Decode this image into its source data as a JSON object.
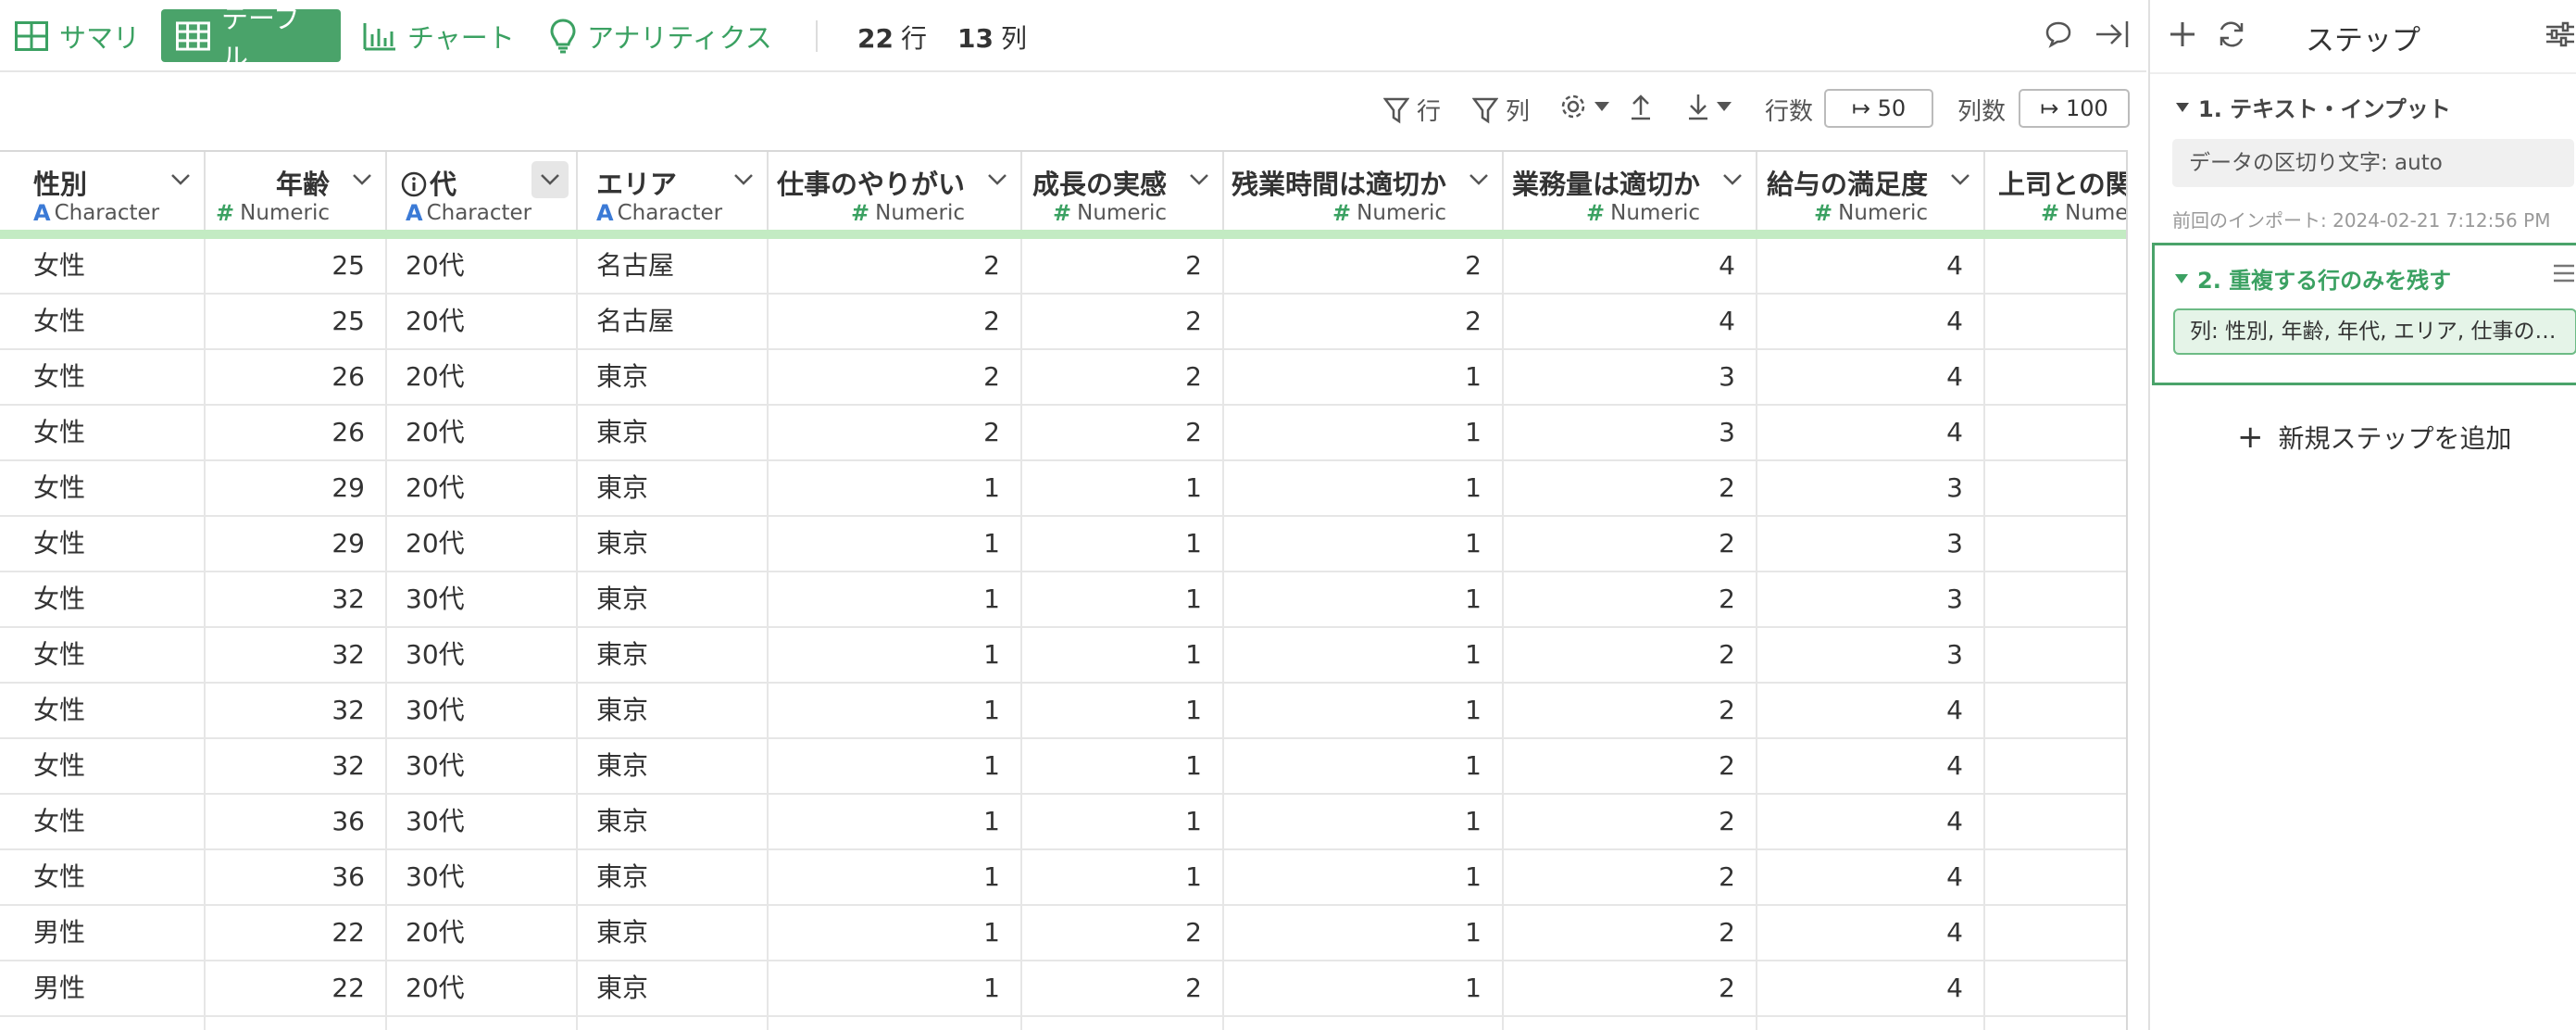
{
  "tabs": [
    {
      "label": "サマリ",
      "icon": "table-grid-icon"
    },
    {
      "label": "テーブル",
      "icon": "table-icon",
      "active": true
    },
    {
      "label": "チャート",
      "icon": "bar-chart-icon"
    },
    {
      "label": "アナリティクス",
      "icon": "lightbulb-icon"
    }
  ],
  "counts": {
    "rows_num": "22",
    "rows_unit": "行",
    "cols_num": "13",
    "cols_unit": "列"
  },
  "toolbar": {
    "row_filter": "行",
    "col_filter": "列",
    "row_count_label": "行数",
    "row_count_value": "↦ 50",
    "col_count_label": "列数",
    "col_count_value": "↦ 100"
  },
  "columns": [
    {
      "name": "性別",
      "type": "Character",
      "kind": "char"
    },
    {
      "name": "年齢",
      "type": "Numeric",
      "kind": "num"
    },
    {
      "name": "代",
      "type": "Character",
      "kind": "char"
    },
    {
      "name": "エリア",
      "type": "Character",
      "kind": "char"
    },
    {
      "name": "仕事のやりがい",
      "type": "Numeric",
      "kind": "num"
    },
    {
      "name": "成長の実感",
      "type": "Numeric",
      "kind": "num"
    },
    {
      "name": "残業時間は適切か",
      "type": "Numeric",
      "kind": "num"
    },
    {
      "name": "業務量は適切か",
      "type": "Numeric",
      "kind": "num"
    },
    {
      "name": "給与の満足度",
      "type": "Numeric",
      "kind": "num"
    },
    {
      "name": "上司との関",
      "type": "Numeric",
      "kind": "num"
    }
  ],
  "rows": [
    [
      "女性",
      "25",
      "20代",
      "名古屋",
      "2",
      "2",
      "2",
      "4",
      "4",
      ""
    ],
    [
      "女性",
      "25",
      "20代",
      "名古屋",
      "2",
      "2",
      "2",
      "4",
      "4",
      ""
    ],
    [
      "女性",
      "26",
      "20代",
      "東京",
      "2",
      "2",
      "1",
      "3",
      "4",
      ""
    ],
    [
      "女性",
      "26",
      "20代",
      "東京",
      "2",
      "2",
      "1",
      "3",
      "4",
      ""
    ],
    [
      "女性",
      "29",
      "20代",
      "東京",
      "1",
      "1",
      "1",
      "2",
      "3",
      ""
    ],
    [
      "女性",
      "29",
      "20代",
      "東京",
      "1",
      "1",
      "1",
      "2",
      "3",
      ""
    ],
    [
      "女性",
      "32",
      "30代",
      "東京",
      "1",
      "1",
      "1",
      "2",
      "3",
      ""
    ],
    [
      "女性",
      "32",
      "30代",
      "東京",
      "1",
      "1",
      "1",
      "2",
      "3",
      ""
    ],
    [
      "女性",
      "32",
      "30代",
      "東京",
      "1",
      "1",
      "1",
      "2",
      "4",
      ""
    ],
    [
      "女性",
      "32",
      "30代",
      "東京",
      "1",
      "1",
      "1",
      "2",
      "4",
      ""
    ],
    [
      "女性",
      "36",
      "30代",
      "東京",
      "1",
      "1",
      "1",
      "2",
      "4",
      ""
    ],
    [
      "女性",
      "36",
      "30代",
      "東京",
      "1",
      "1",
      "1",
      "2",
      "4",
      ""
    ],
    [
      "男性",
      "22",
      "20代",
      "東京",
      "1",
      "2",
      "1",
      "2",
      "4",
      ""
    ],
    [
      "男性",
      "22",
      "20代",
      "東京",
      "1",
      "2",
      "1",
      "2",
      "4",
      ""
    ],
    [
      "",
      "",
      "",
      "",
      "",
      "",
      "",
      "",
      "",
      ""
    ]
  ],
  "panel": {
    "title": "ステップ",
    "step1": {
      "title": "1. テキスト・インプット",
      "delimiter": "データの区切り文字: auto",
      "note": "前回のインポート: 2024-02-21 7:12:56 PM"
    },
    "step2": {
      "title": "2. 重複する行のみを残す",
      "columns": "列: 性別, 年齢, 年代, エリア, 仕事の…"
    },
    "add_step": "新規ステップを追加"
  },
  "colors": {
    "accent": "#4aa36a",
    "highlight": "#c3ebc3",
    "char_type": "#3b7ad6"
  }
}
